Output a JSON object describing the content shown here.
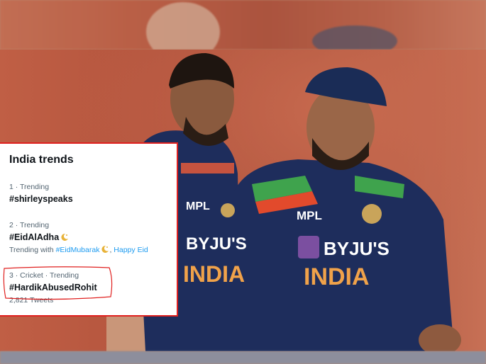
{
  "trends_card": {
    "title": "India trends",
    "items": [
      {
        "meta": "1 · Trending",
        "name": "#shirleyspeaks"
      },
      {
        "meta": "2 · Trending",
        "name": "#EidAlAdha",
        "with_prefix": "Trending with",
        "with_link_1": "#EidMubarak",
        "with_sep": ",",
        "with_link_2": "Happy Eid"
      },
      {
        "meta": "3 · Cricket · Trending",
        "name": "#HardikAbusedRohit",
        "count": "2,821 Tweets"
      }
    ]
  },
  "jerseys": {
    "left_sponsor": "BYJU'S",
    "left_team": "INDIA",
    "left_brand": "MPL",
    "right_sponsor": "BYJU'S",
    "right_team": "INDIA",
    "right_brand": "MPL"
  },
  "colors": {
    "highlight_border": "#e0201f",
    "link": "#1d9bf0",
    "jersey": "#1e2d5c"
  },
  "icons": [
    "crescent-moon-icon"
  ]
}
